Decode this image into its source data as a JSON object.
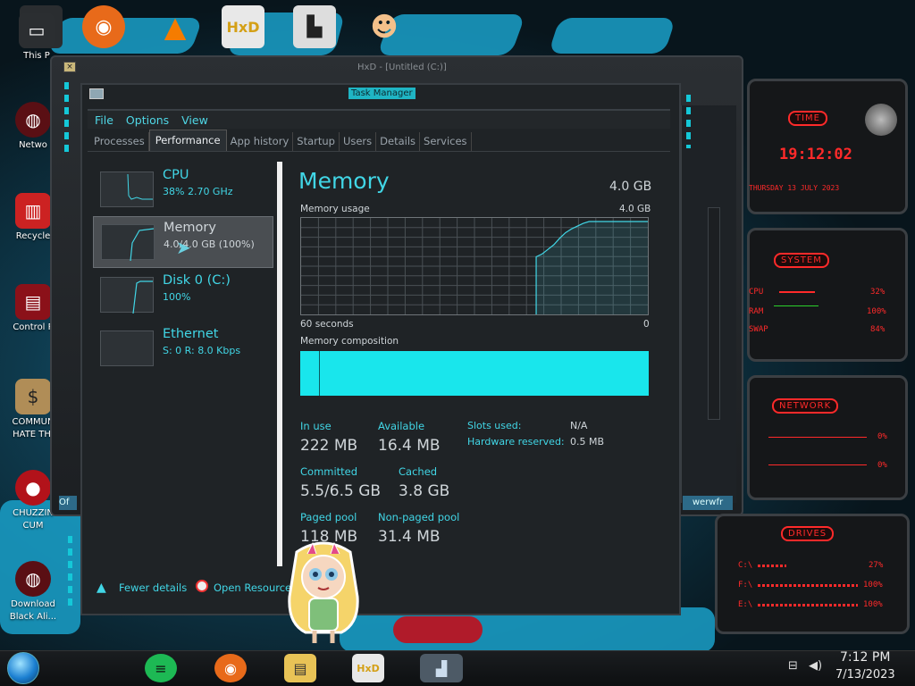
{
  "desktop": {
    "icons": [
      {
        "label": "This P"
      },
      {
        "label": "Netwo"
      },
      {
        "label": "Recycle"
      },
      {
        "label": "Control P"
      },
      {
        "label": "COMMUN\nHATE THI"
      },
      {
        "label": "CHUZZIN\nCUM"
      },
      {
        "label": "Download\nBlack Ali..."
      }
    ]
  },
  "hxd": {
    "title": "HxD - [Untitled (C:)]",
    "status_right": "werwfr",
    "status_left": "Of"
  },
  "task_manager": {
    "title": "Task Manager",
    "menu": [
      "File",
      "Options",
      "View"
    ],
    "tabs": [
      "Processes",
      "Performance",
      "App history",
      "Startup",
      "Users",
      "Details",
      "Services"
    ],
    "active_tab": "Performance",
    "resources": [
      {
        "name": "CPU",
        "sub": "38%  2.70 GHz"
      },
      {
        "name": "Memory",
        "sub": "4.0/4.0 GB (100%)"
      },
      {
        "name": "Disk 0 (C:)",
        "sub": "100%"
      },
      {
        "name": "Ethernet",
        "sub": "S: 0  R: 8.0 Kbps"
      }
    ],
    "detail": {
      "title": "Memory",
      "total": "4.0 GB",
      "usage_label": "Memory usage",
      "usage_max": "4.0 GB",
      "time_left": "60 seconds",
      "time_right": "0",
      "composition_label": "Memory composition",
      "usage_series": [
        0,
        0,
        0,
        0,
        0,
        0,
        0,
        0,
        0,
        0,
        0,
        0,
        0,
        0,
        0,
        0,
        0,
        0,
        0,
        0,
        0,
        0,
        0,
        0,
        0,
        0,
        0,
        0,
        0,
        0,
        0,
        0,
        0,
        0,
        0,
        0,
        0,
        0,
        0,
        0,
        0.62,
        0.65,
        0.7,
        0.75,
        0.82,
        0.88,
        0.92,
        0.95,
        0.98,
        1.0,
        1.0,
        1.0,
        1.0,
        1.0,
        1.0,
        1.0,
        1.0,
        1.0,
        1.0,
        1.0
      ],
      "stats": {
        "in_use_label": "In use",
        "in_use": "222 MB",
        "available_label": "Available",
        "available": "16.4 MB",
        "committed_label": "Committed",
        "committed": "5.5/6.5 GB",
        "cached_label": "Cached",
        "cached": "3.8 GB",
        "paged_label": "Paged pool",
        "paged": "118 MB",
        "nonpaged_label": "Non-paged pool",
        "nonpaged": "31.4 MB"
      },
      "kv": {
        "slots_label": "Slots used:",
        "slots": "N/A",
        "hw_label": "Hardware reserved:",
        "hw": "0.5 MB"
      }
    },
    "footer": {
      "fewer": "Fewer details",
      "resmon": "Open Resource"
    }
  },
  "gadgets": {
    "time": {
      "head": "TIME",
      "clock": "19:12:02",
      "date": "THURSDAY 13 JULY 2023"
    },
    "system": {
      "head": "SYSTEM",
      "rows": [
        {
          "label": "CPU",
          "value": "32%"
        },
        {
          "label": "RAM",
          "value": "100%"
        },
        {
          "label": "SWAP",
          "value": "84%"
        }
      ]
    },
    "network": {
      "head": "NETWORK",
      "rows": [
        {
          "value": "0%"
        },
        {
          "value": "0%"
        }
      ]
    },
    "drives": {
      "head": "DRIVES",
      "rows": [
        {
          "label": "C:\\",
          "value": "27%"
        },
        {
          "label": "F:\\",
          "value": "100%"
        },
        {
          "label": "E:\\",
          "value": "100%"
        }
      ]
    }
  },
  "taskbar": {
    "time": "7:12 PM",
    "date": "7/13/2023"
  },
  "colors": {
    "accent": "#41d6e6",
    "composition": "#19e6ec",
    "gadget_red": "#ff2a2a"
  }
}
